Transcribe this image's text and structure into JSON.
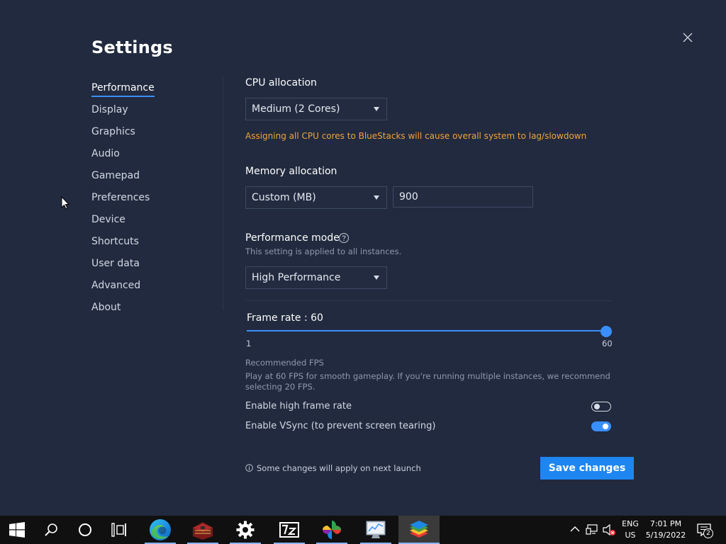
{
  "settings": {
    "title": "Settings",
    "nav": {
      "performance": "Performance",
      "display": "Display",
      "graphics": "Graphics",
      "audio": "Audio",
      "gamepad": "Gamepad",
      "preferences": "Preferences",
      "device": "Device",
      "shortcuts": "Shortcuts",
      "user_data": "User data",
      "advanced": "Advanced",
      "about": "About"
    },
    "active_nav": "Performance"
  },
  "performance": {
    "cpu": {
      "label": "CPU allocation",
      "selected": "Medium (2 Cores)",
      "warning": "Assigning all CPU cores to BlueStacks will cause overall system to lag/slowdown"
    },
    "memory": {
      "label": "Memory allocation",
      "selected": "Custom (MB)",
      "value": "900"
    },
    "mode": {
      "label": "Performance mode",
      "note": "This setting is applied to all instances.",
      "selected": "High Performance"
    },
    "frame_rate": {
      "label": "Frame rate : 60",
      "value": 60,
      "min_label": "1",
      "max_label": "60",
      "recommended_title": "Recommended FPS",
      "recommended_line1": "Play at 60 FPS for smooth gameplay. If you're running multiple instances, we recommend",
      "recommended_line2": "selecting 20 FPS."
    },
    "high_frame_rate": {
      "label": "Enable high frame rate",
      "enabled": false
    },
    "vsync": {
      "label": "Enable VSync (to prevent screen tearing)",
      "enabled": true
    },
    "footnote": "Some changes will apply on next launch",
    "save_label": "Save changes"
  },
  "taskbar": {
    "icons": [
      "windows-start-icon",
      "search-icon",
      "cortana-icon",
      "task-view-icon",
      "edge-icon",
      "winrar-icon",
      "settings-gear-icon",
      "7zip-icon",
      "app-cross-icon",
      "performance-monitor-icon",
      "bluestacks-icon"
    ],
    "tray": {
      "lang_line1": "ENG",
      "lang_line2": "US",
      "time": "7:01 PM",
      "date": "5/19/2022",
      "notifications_count": "2"
    }
  },
  "colors": {
    "background": "#212a3e",
    "accent": "#3a8fff",
    "warning": "#f2a33a",
    "save_button": "#1e86f0"
  }
}
